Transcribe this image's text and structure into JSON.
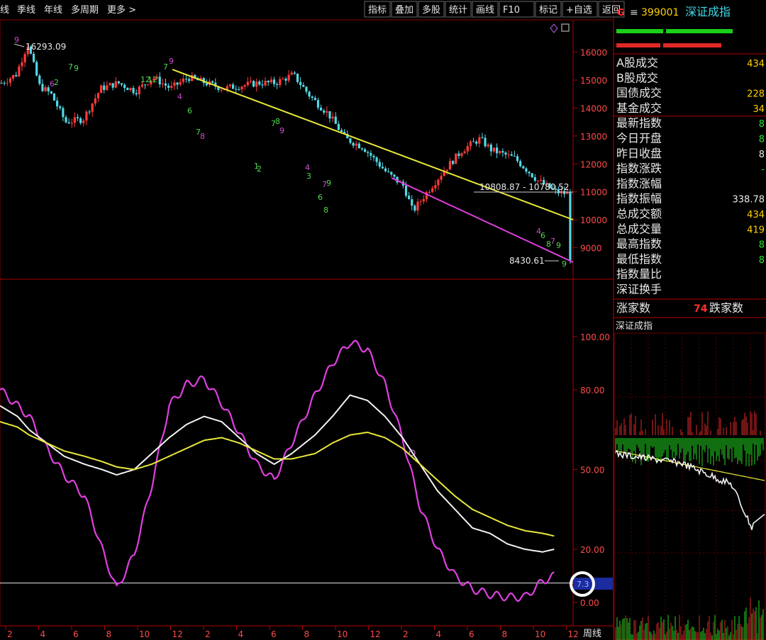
{
  "colors": {
    "bg": "#000000",
    "frame": "#b00000",
    "up": "#ff3b3b",
    "down": "#54d8e6",
    "yellow": "#e8e83a",
    "magenta": "#e040e0",
    "white": "#f2f2f2",
    "axis_text": "#ff4b4b",
    "label": "#e8e8e8",
    "green_bar": "#1ad01a",
    "red_bar": "#e02828"
  },
  "toolbar": {
    "left_tabs": [
      "线",
      "季线",
      "年线",
      "多周期",
      "更多 >"
    ],
    "right_tabs": [
      "指标",
      "叠加",
      "多股",
      "统计",
      "画线",
      "F10",
      "标记",
      "+自选",
      "返回"
    ]
  },
  "right_panel": {
    "header": {
      "g_icon": "G",
      "menu_icon": "≡",
      "code": "399001",
      "name": "深证成指"
    },
    "rows": [
      {
        "label": "A股成交",
        "value": "434",
        "color": "#ffd000"
      },
      {
        "label": "B股成交",
        "value": "",
        "color": "#ffd000"
      },
      {
        "label": "国债成交",
        "value": "228",
        "color": "#ffd000"
      },
      {
        "label": "基金成交",
        "value": "34",
        "color": "#ffd000"
      },
      {
        "label": "最新指数",
        "value": "8",
        "color": "#2ee02e"
      },
      {
        "label": "今日开盘",
        "value": "8",
        "color": "#2ee02e"
      },
      {
        "label": "昨日收盘",
        "value": "8",
        "color": "#e8e8e8"
      },
      {
        "label": "指数涨跌",
        "value": "-",
        "color": "#2ee02e"
      },
      {
        "label": "指数涨幅",
        "value": "",
        "color": "#2ee02e"
      },
      {
        "label": "指数振幅",
        "value": "338.78",
        "color": "#e8e8e8"
      },
      {
        "label": "总成交额",
        "value": "434",
        "color": "#ffd000"
      },
      {
        "label": "总成交量",
        "value": "419",
        "color": "#ffd000"
      },
      {
        "label": "最高指数",
        "value": "8",
        "color": "#2ee02e"
      },
      {
        "label": "最低指数",
        "value": "8",
        "color": "#2ee02e"
      },
      {
        "label": "指数量比",
        "value": "",
        "color": "#e8e8e8"
      },
      {
        "label": "深证换手",
        "value": "",
        "color": "#e8e8e8"
      }
    ],
    "rise_label": "涨家数",
    "rise_value": "74",
    "fall_label": "跌家数",
    "mini_title": "深证成指"
  },
  "bottom": {
    "period": "周线",
    "month_ticks": [
      "2",
      "4",
      "6",
      "8",
      "10",
      "12",
      "2",
      "4",
      "6",
      "8",
      "10",
      "12",
      "2",
      "4",
      "6",
      "8",
      "10",
      "12"
    ]
  },
  "chart_data": [
    {
      "type": "candlestick",
      "title": "",
      "yticks": [
        9000,
        10000,
        11000,
        12000,
        13000,
        14000,
        15000,
        16000
      ],
      "ylim": [
        8100,
        16600
      ],
      "x_count": 195,
      "anchors": [
        [
          0,
          14900
        ],
        [
          5,
          15200
        ],
        [
          9,
          16293
        ],
        [
          13,
          14800
        ],
        [
          17,
          14500
        ],
        [
          22,
          13500
        ],
        [
          28,
          13600
        ],
        [
          34,
          14700
        ],
        [
          40,
          14900
        ],
        [
          46,
          14600
        ],
        [
          52,
          15100
        ],
        [
          58,
          14700
        ],
        [
          64,
          15100
        ],
        [
          70,
          14900
        ],
        [
          76,
          14700
        ],
        [
          82,
          14800
        ],
        [
          88,
          14900
        ],
        [
          94,
          14900
        ],
        [
          100,
          15200
        ],
        [
          106,
          14400
        ],
        [
          112,
          13800
        ],
        [
          118,
          12900
        ],
        [
          124,
          12600
        ],
        [
          132,
          11700
        ],
        [
          138,
          11200
        ],
        [
          141,
          10300
        ],
        [
          146,
          11000
        ],
        [
          152,
          11800
        ],
        [
          158,
          12500
        ],
        [
          164,
          12900
        ],
        [
          168,
          12500
        ],
        [
          176,
          12200
        ],
        [
          184,
          11400
        ],
        [
          190,
          11000
        ],
        [
          196,
          10900
        ]
      ],
      "annotations": {
        "high_label": "16293.09",
        "low_label": "8430.61",
        "range_label": "10808.87 - 10780.52",
        "td_numbers": [
          "9",
          "7",
          "9",
          "6",
          "2",
          "12",
          "9",
          "7",
          "12",
          "4",
          "6",
          "7",
          "8",
          "7",
          "8",
          "9",
          "1",
          "2",
          "4",
          "3",
          "6",
          "7",
          "8",
          "9",
          "4",
          "6",
          "8",
          "7",
          "9",
          "9"
        ]
      },
      "low_value": 8430.61,
      "high_value": 16293.09
    },
    {
      "type": "line",
      "title": "",
      "yticks": [
        0.0,
        20.0,
        50.0,
        80.0,
        100.0
      ],
      "ytick_labels": [
        "0.00",
        "20.00",
        "50.00",
        "80.00",
        "100.00"
      ],
      "ylim": [
        -8,
        120
      ],
      "reference_line": 7.3,
      "current_label": "7.3",
      "series": [
        {
          "color": "magenta",
          "anchors": [
            [
              0,
              80
            ],
            [
              6,
              74
            ],
            [
              10,
              70
            ],
            [
              16,
              58
            ],
            [
              22,
              48
            ],
            [
              29,
              40
            ],
            [
              35,
              20
            ],
            [
              40,
              5
            ],
            [
              46,
              18
            ],
            [
              52,
              44
            ],
            [
              58,
              74
            ],
            [
              64,
              82
            ],
            [
              70,
              84
            ],
            [
              76,
              75
            ],
            [
              82,
              64
            ],
            [
              88,
              52
            ],
            [
              94,
              46
            ],
            [
              100,
              60
            ],
            [
              108,
              78
            ],
            [
              114,
              90
            ],
            [
              120,
              98
            ],
            [
              126,
              95
            ],
            [
              132,
              82
            ],
            [
              138,
              62
            ],
            [
              144,
              36
            ],
            [
              150,
              20
            ],
            [
              156,
              10
            ],
            [
              162,
              5
            ],
            [
              168,
              3
            ],
            [
              174,
              2
            ],
            [
              180,
              2
            ],
            [
              186,
              8
            ],
            [
              190,
              10
            ]
          ]
        },
        {
          "color": "white",
          "anchors": [
            [
              0,
              74
            ],
            [
              6,
              70
            ],
            [
              10,
              65
            ],
            [
              16,
              60
            ],
            [
              22,
              55
            ],
            [
              29,
              52
            ],
            [
              35,
              50
            ],
            [
              40,
              48
            ],
            [
              46,
              50
            ],
            [
              52,
              56
            ],
            [
              58,
              62
            ],
            [
              64,
              67
            ],
            [
              70,
              70
            ],
            [
              76,
              68
            ],
            [
              82,
              62
            ],
            [
              88,
              56
            ],
            [
              94,
              52
            ],
            [
              100,
              56
            ],
            [
              108,
              63
            ],
            [
              114,
              70
            ],
            [
              120,
              78
            ],
            [
              126,
              76
            ],
            [
              132,
              70
            ],
            [
              138,
              62
            ],
            [
              144,
              52
            ],
            [
              150,
              42
            ],
            [
              156,
              35
            ],
            [
              162,
              28
            ],
            [
              168,
              26
            ],
            [
              174,
              22
            ],
            [
              180,
              20
            ],
            [
              186,
              19
            ],
            [
              190,
              20
            ]
          ]
        },
        {
          "color": "yellow",
          "anchors": [
            [
              0,
              68
            ],
            [
              6,
              66
            ],
            [
              10,
              63
            ],
            [
              16,
              60
            ],
            [
              22,
              57
            ],
            [
              29,
              55
            ],
            [
              35,
              53
            ],
            [
              40,
              51
            ],
            [
              46,
              50
            ],
            [
              52,
              52
            ],
            [
              58,
              55
            ],
            [
              64,
              58
            ],
            [
              70,
              61
            ],
            [
              76,
              62
            ],
            [
              82,
              60
            ],
            [
              88,
              57
            ],
            [
              94,
              54
            ],
            [
              100,
              54
            ],
            [
              108,
              56
            ],
            [
              114,
              60
            ],
            [
              120,
              63
            ],
            [
              126,
              64
            ],
            [
              132,
              62
            ],
            [
              138,
              58
            ],
            [
              144,
              52
            ],
            [
              150,
              46
            ],
            [
              156,
              40
            ],
            [
              162,
              35
            ],
            [
              168,
              32
            ],
            [
              174,
              29
            ],
            [
              180,
              27
            ],
            [
              186,
              26
            ],
            [
              190,
              25
            ]
          ]
        }
      ]
    }
  ]
}
